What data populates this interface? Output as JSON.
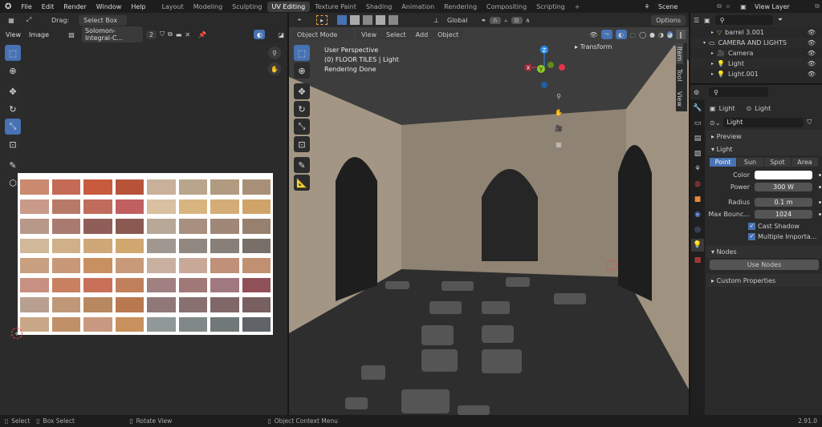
{
  "topbar": {
    "menus": [
      "File",
      "Edit",
      "Render",
      "Window",
      "Help"
    ],
    "workspaces": [
      "Layout",
      "Modeling",
      "Sculpting",
      "UV Editing",
      "Texture Paint",
      "Shading",
      "Animation",
      "Rendering",
      "Compositing",
      "Scripting"
    ],
    "active_workspace": "UV Editing",
    "add_tab": "+",
    "scene": "Scene",
    "view_layer": "View Layer"
  },
  "uv_editor": {
    "drag_label": "Drag:",
    "drag_value": "Select Box",
    "menus": [
      "View",
      "Image"
    ],
    "image_name": "Solomon-Integral-C...",
    "image_users": "2",
    "swatch_colors": [
      [
        "#c98a70",
        "#c56a55",
        "#c85a3e",
        "#b8533a",
        "#c8b09a",
        "#b8a58c",
        "#b09a80",
        "#a89078"
      ],
      [
        "#c99a88",
        "#b87a68",
        "#c06c5c",
        "#c06060",
        "#d8c0a0",
        "#d8b480",
        "#d4ac78",
        "#d0a468"
      ],
      [
        "#b89888",
        "#a87a70",
        "#905e58",
        "#8a5a52",
        "#b8a898",
        "#a89080",
        "#a08878",
        "#98806e"
      ],
      [
        "#d0b898",
        "#d0b088",
        "#d0a878",
        "#d0a870",
        "#a09890",
        "#908880",
        "#888078",
        "#787068"
      ],
      [
        "#c8a080",
        "#c89878",
        "#c89060",
        "#c89a7a",
        "#c8b0a0",
        "#c8a898",
        "#c09078",
        "#c09070"
      ],
      [
        "#c89080",
        "#c88060",
        "#c87058",
        "#c0805c",
        "#a08080",
        "#a07878",
        "#a07880",
        "#905058"
      ],
      [
        "#b8a090",
        "#c09878",
        "#b88860",
        "#b87850",
        "#907878",
        "#887070",
        "#806868",
        "#786060"
      ],
      [
        "#c8a888",
        "#c09068",
        "#c89880",
        "#c8905c",
        "#909898",
        "#808888",
        "#707878",
        "#606468"
      ]
    ]
  },
  "viewport": {
    "mode": "Object Mode",
    "menus": [
      "View",
      "Select",
      "Add",
      "Object"
    ],
    "orientation": "Global",
    "options": "Options",
    "overlay_lines": [
      "User Perspective",
      "(0) FLOOR TILES | Light",
      "Rendering Done"
    ],
    "transform_panel": "Transform",
    "side_tabs": [
      "Item",
      "Tool",
      "View"
    ],
    "gizmo_axes": {
      "x": "X",
      "y": "Y",
      "z": "Z"
    },
    "colors": {
      "x": "#e0344f",
      "y": "#8bc924",
      "z": "#2d8ceb"
    }
  },
  "outliner": {
    "items": [
      {
        "name": "barrel 3.001",
        "type": "mesh",
        "indent": 1
      },
      {
        "name": "CAMERA AND LIGHTS",
        "type": "collection",
        "indent": 0
      },
      {
        "name": "Camera",
        "type": "camera",
        "indent": 1
      },
      {
        "name": "Light",
        "type": "light",
        "indent": 1
      },
      {
        "name": "Light.001",
        "type": "light",
        "indent": 1
      }
    ]
  },
  "properties": {
    "breadcrumb": [
      "Light",
      "Light"
    ],
    "datablock": "Light",
    "panels": {
      "preview": "Preview",
      "light": "Light",
      "nodes": "Nodes",
      "custom": "Custom Properties"
    },
    "light_types": [
      "Point",
      "Sun",
      "Spot",
      "Area"
    ],
    "active_type": "Point",
    "fields": {
      "color_label": "Color",
      "color_value": "#ffffff",
      "power_label": "Power",
      "power": "300 W",
      "radius_label": "Radius",
      "radius": "0.1 m",
      "bounces_label": "Max Bounc...",
      "bounces": "1024"
    },
    "checkboxes": [
      {
        "label": "Cast Shadow",
        "checked": true
      },
      {
        "label": "Multiple Importa...",
        "checked": true
      }
    ],
    "use_nodes": "Use Nodes"
  },
  "statusbar": {
    "hints": [
      "Select",
      "Box Select",
      "Rotate View",
      "Object Context Menu"
    ],
    "version": "2.91.0"
  }
}
